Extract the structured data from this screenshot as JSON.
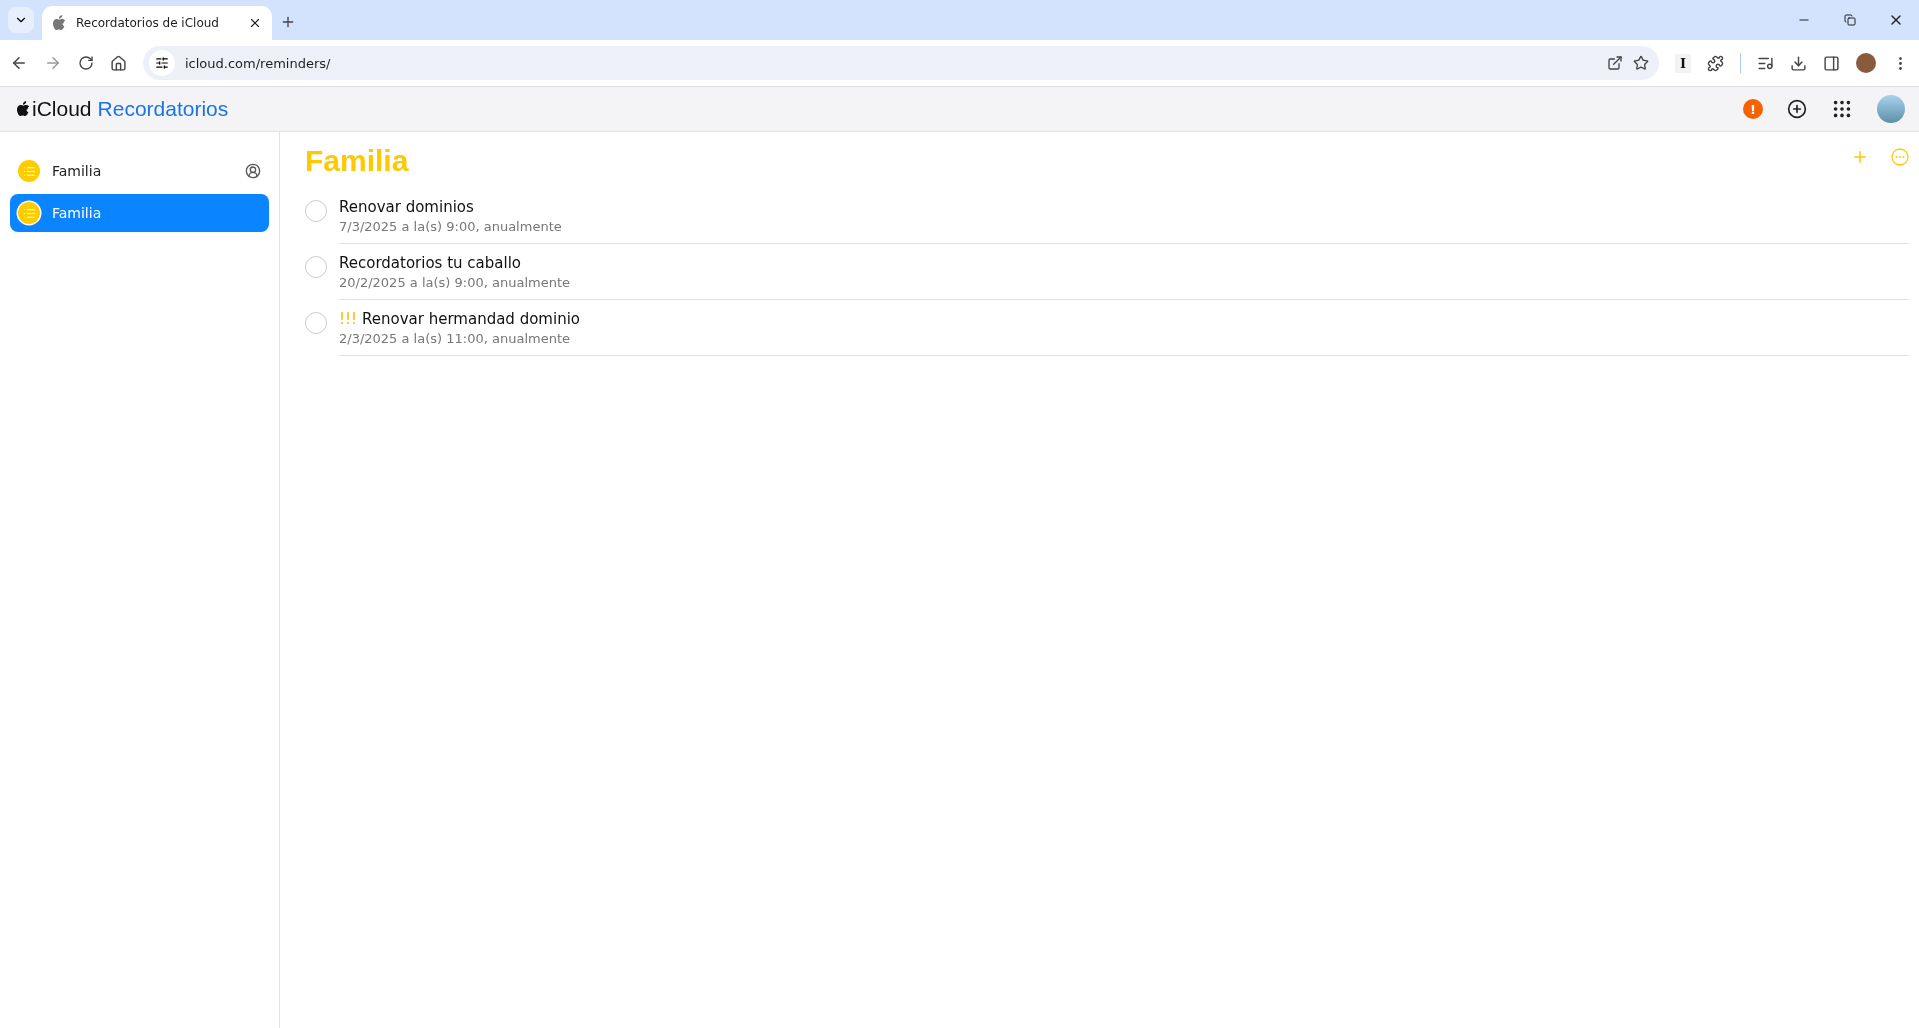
{
  "browser": {
    "tab_title": "Recordatorios de iCloud",
    "url": "icloud.com/reminders/",
    "extension_label": "I"
  },
  "app": {
    "brand": "iCloud",
    "name": "Recordatorios",
    "alert": "!"
  },
  "sidebar": {
    "items": [
      {
        "label": "Familia",
        "selected": false,
        "shared": true
      },
      {
        "label": "Familia",
        "selected": true,
        "shared": false
      }
    ]
  },
  "list": {
    "title": "Familia",
    "reminders": [
      {
        "title": "Renovar dominios",
        "detail": "7/3/2025 a la(s) 9:00, anualmente",
        "completed": false
      },
      {
        "title": "Recordatorios tu caballo",
        "detail": "20/2/2025 a la(s) 9:00, anualmente",
        "completed": false
      },
      {
        "priority": "!!!",
        "title": "Renovar hermandad dominio",
        "detail": "2/3/2025 a la(s) 11:00, anualmente",
        "completed": false
      }
    ]
  }
}
